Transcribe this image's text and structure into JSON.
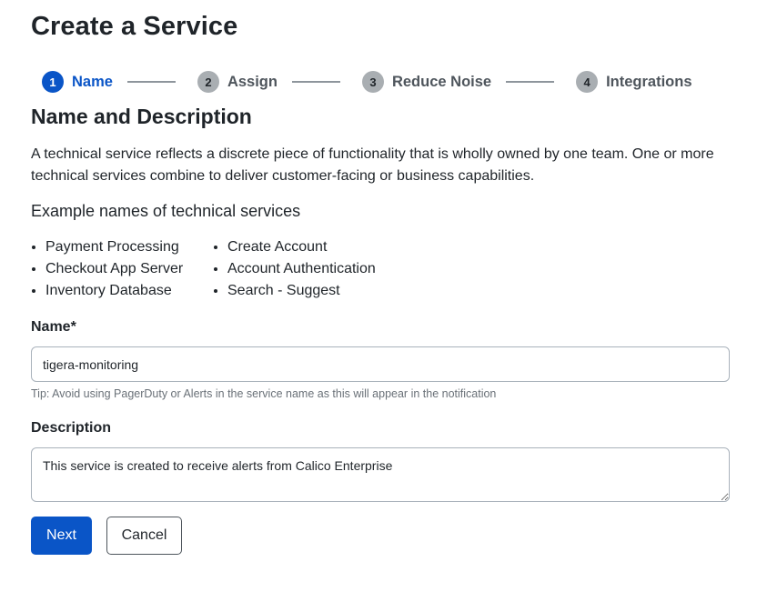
{
  "page": {
    "title": "Create a Service"
  },
  "stepper": {
    "steps": [
      {
        "number": "1",
        "label": "Name",
        "active": true
      },
      {
        "number": "2",
        "label": "Assign",
        "active": false
      },
      {
        "number": "3",
        "label": "Reduce Noise",
        "active": false
      },
      {
        "number": "4",
        "label": "Integrations",
        "active": false
      }
    ]
  },
  "section": {
    "heading": "Name and Description",
    "intro": "A technical service reflects a discrete piece of functionality that is wholly owned by one team. One or more technical services combine to deliver customer-facing or business capabilities.",
    "examples_heading": "Example names of technical services",
    "examples_col1": [
      "Payment Processing",
      "Checkout App Server",
      "Inventory Database"
    ],
    "examples_col2": [
      "Create Account",
      "Account Authentication",
      "Search - Suggest"
    ]
  },
  "form": {
    "name_label": "Name*",
    "name_value": "tigera-monitoring",
    "name_tip": "Tip: Avoid using PagerDuty or Alerts in the service name as this will appear in the notification",
    "description_label": "Description",
    "description_value": "This service is created to receive alerts from Calico Enterprise"
  },
  "buttons": {
    "next_label": "Next",
    "cancel_label": "Cancel"
  },
  "colors": {
    "accent": "#0a55c7",
    "inactive_step": "#a9aeb2"
  }
}
